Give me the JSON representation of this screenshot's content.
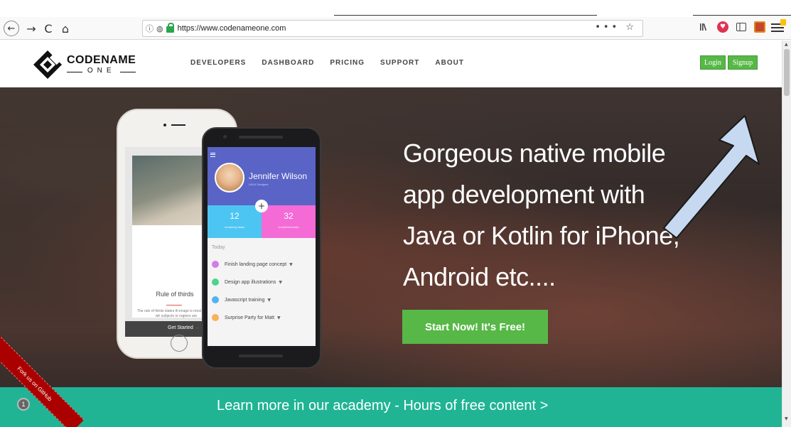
{
  "browser": {
    "url": "https://www.codenameone.com",
    "back_glyph": "←",
    "forward_glyph": "→",
    "reload_glyph": "C",
    "home_glyph": "⌂",
    "page_actions": "•••",
    "bookmark_glyph": "☆",
    "info_glyph": "ⓘ",
    "shield_glyph": "◍"
  },
  "header": {
    "logo_top": "CODENAME",
    "logo_bottom": "ONE",
    "nav": [
      "DEVELOPERS",
      "DASHBOARD",
      "PRICING",
      "SUPPORT",
      "ABOUT"
    ],
    "login_label": "Login",
    "signup_label": "Signup"
  },
  "hero": {
    "headline_lines": [
      "Gorgeous native mobile",
      "app development with",
      "Java or Kotlin for iPhone,",
      "Android etc...."
    ],
    "cta_label": "Start Now! It's Free!"
  },
  "white_phone": {
    "card_title": "Rule of thirds",
    "card_desc": "The rule of thirds states th image is most pleasing wh subjects or regions are",
    "get_started": "Get Started",
    "arrow": "→"
  },
  "black_phone": {
    "name": "Jennifer Wilson",
    "role": "UI/UX Designer",
    "stat_left_num": "12",
    "stat_left_label": "remaining tasks",
    "stat_right_num": "32",
    "stat_right_label": "completed tasks",
    "plus": "+",
    "today": "Today",
    "tasks": [
      {
        "label": "Finish landing page concept",
        "color": "#d27de8"
      },
      {
        "label": "Design app illustrations",
        "color": "#4cd48a"
      },
      {
        "label": "Javascript training",
        "color": "#4db5f0"
      },
      {
        "label": "Surprise Party for Matt",
        "color": "#f7b25a"
      }
    ]
  },
  "teal_band": {
    "text": "Learn more in our academy - Hours of free content >"
  },
  "ribbon": {
    "text": "Fork us on GitHub",
    "bubble": "1"
  },
  "colors": {
    "brand_green": "#57b847",
    "teal": "#20b495",
    "annotation_arrow": "#c6d9f0"
  }
}
